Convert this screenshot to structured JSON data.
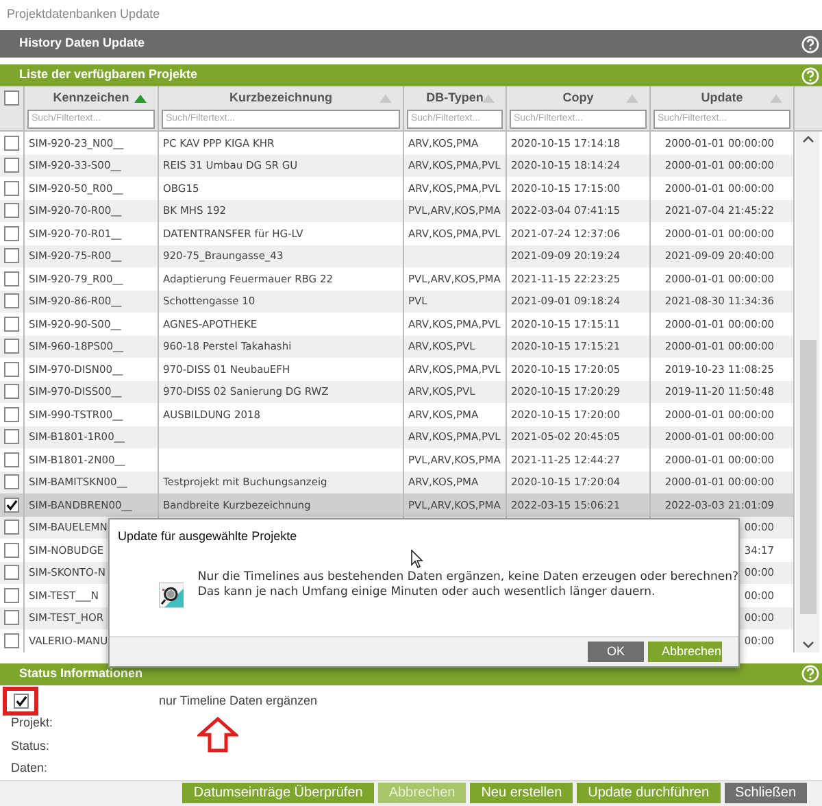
{
  "window": {
    "title": "Projektdatenbanken Update"
  },
  "header": {
    "title": "History Daten Update"
  },
  "list_panel": {
    "title": "Liste der verfügbaren Projekte"
  },
  "table": {
    "all_checked": false,
    "columns": [
      {
        "label": "Kennzeichen",
        "sorted": true,
        "placeholder": "Such/Filtertext..."
      },
      {
        "label": "Kurzbezeichnung",
        "sorted": false,
        "placeholder": "Such/Filtertext..."
      },
      {
        "label": "DB-Typen",
        "sorted": false,
        "placeholder": "Such/Filtertext..."
      },
      {
        "label": "Copy",
        "sorted": false,
        "placeholder": "Such/Filtertext..."
      },
      {
        "label": "Update",
        "sorted": false,
        "placeholder": "Such/Filtertext..."
      }
    ],
    "rows": [
      {
        "checked": false,
        "selected": false,
        "cells": [
          "SIM-920-23_N00__",
          "PC KAV PPP KIGA KHR",
          "ARV,KOS,PMA",
          "2020-10-15 17:14:18",
          "2000-01-01 00:00:00"
        ]
      },
      {
        "checked": false,
        "selected": false,
        "cells": [
          "SIM-920-33-S00__",
          "REIS 31 Umbau DG SR GU",
          "ARV,KOS,PMA,PVL",
          "2020-10-15 18:14:24",
          "2000-01-01 00:00:00"
        ]
      },
      {
        "checked": false,
        "selected": false,
        "cells": [
          "SIM-920-50_R00__",
          "OBG15",
          "ARV,KOS,PMA,PVL",
          "2020-10-15 17:15:00",
          "2000-01-01 00:00:00"
        ]
      },
      {
        "checked": false,
        "selected": false,
        "cells": [
          "SIM-920-70-R00__",
          "BK MHS 192",
          "PVL,ARV,KOS,PMA",
          "2022-03-04 07:41:15",
          "2021-07-04 21:45:22"
        ]
      },
      {
        "checked": false,
        "selected": false,
        "cells": [
          "SIM-920-70-R01__",
          "DATENTRANSFER für HG-LV",
          "ARV,KOS,PMA,PVL",
          "2021-07-24 12:37:06",
          "2000-01-01 00:00:00"
        ]
      },
      {
        "checked": false,
        "selected": false,
        "cells": [
          "SIM-920-75-R00__",
          "920-75_Braungasse_43",
          null,
          "2021-09-09 20:19:24",
          "2021-09-09 20:40:00"
        ]
      },
      {
        "checked": false,
        "selected": false,
        "cells": [
          "SIM-920-79_R00__",
          "Adaptierung Feuermauer RBG 22",
          "PVL,ARV,KOS,PMA",
          "2021-11-15 22:23:25",
          "2000-01-01 00:00:00"
        ]
      },
      {
        "checked": false,
        "selected": false,
        "cells": [
          "SIM-920-86-R00__",
          "Schottengasse 10",
          "PVL",
          "2021-09-01 09:18:24",
          "2021-08-30 11:34:36"
        ]
      },
      {
        "checked": false,
        "selected": false,
        "cells": [
          "SIM-920-90-S00__",
          "AGNES-APOTHEKE",
          "ARV,KOS,PMA,PVL",
          "2020-10-15 17:15:11",
          "2000-01-01 00:00:00"
        ]
      },
      {
        "checked": false,
        "selected": false,
        "cells": [
          "SIM-960-18PS00__",
          "960-18 Perstel Takahashi",
          "ARV,KOS,PVL",
          "2020-10-15 17:15:21",
          "2000-01-01 00:00:00"
        ]
      },
      {
        "checked": false,
        "selected": false,
        "cells": [
          "SIM-970-DISN00__",
          "970-DISS 01 NeubauEFH",
          "ARV,KOS,PMA,PVL",
          "2020-10-15 17:20:05",
          "2019-10-23 11:08:25"
        ]
      },
      {
        "checked": false,
        "selected": false,
        "cells": [
          "SIM-970-DISS00__",
          "970-DISS 02 Sanierung DG RWZ",
          "ARV,KOS,PVL",
          "2020-10-15 17:20:29",
          "2019-11-20 11:50:48"
        ]
      },
      {
        "checked": false,
        "selected": false,
        "cells": [
          "SIM-990-TSTR00__",
          "AUSBILDUNG 2018",
          "ARV,KOS,PMA",
          "2020-10-15 17:20:00",
          "2000-01-01 00:00:00"
        ]
      },
      {
        "checked": false,
        "selected": false,
        "cells": [
          "SIM-B1801-1R00__",
          null,
          "ARV,KOS,PMA,PVL",
          "2021-05-02 20:45:05",
          "2000-01-01 00:00:00"
        ]
      },
      {
        "checked": false,
        "selected": false,
        "cells": [
          "SIM-B1801-2N00__",
          null,
          "PVL,ARV,KOS,PMA",
          "2021-11-25 12:44:27",
          "2000-01-01 00:00:00"
        ]
      },
      {
        "checked": false,
        "selected": false,
        "cells": [
          "SIM-BAMITSKN00__",
          "Testprojekt mit Buchungsanzeig",
          "ARV,KOS,PMA",
          "2020-10-15 17:20:04",
          "2000-01-01 00:00:00"
        ]
      },
      {
        "checked": true,
        "selected": true,
        "cells": [
          "SIM-BANDBREN00__",
          "Bandbreite Kurzbezeichnung",
          "PVL,ARV,KOS,PMA",
          "2022-03-15 15:06:21",
          "2022-03-03 21:01:09"
        ]
      },
      {
        "checked": false,
        "selected": false,
        "cells": [
          "SIM-BAUELEMN",
          null,
          null,
          null,
          "00:00"
        ]
      },
      {
        "checked": false,
        "selected": false,
        "cells": [
          "SIM-NOBUDGE",
          null,
          null,
          null,
          "34:17"
        ]
      },
      {
        "checked": false,
        "selected": false,
        "cells": [
          "SIM-SKONTO-N",
          null,
          null,
          null,
          "00:00"
        ]
      },
      {
        "checked": false,
        "selected": false,
        "cells": [
          "SIM-TEST___N",
          null,
          null,
          null,
          "00:00"
        ]
      },
      {
        "checked": false,
        "selected": false,
        "cells": [
          "SIM-TEST_HOR",
          null,
          null,
          null,
          "00:00"
        ]
      },
      {
        "checked": false,
        "selected": false,
        "cells": [
          "VALERIO-MANU",
          null,
          null,
          null,
          "00:00"
        ]
      }
    ]
  },
  "dialog": {
    "title": "Update für ausgewählte Projekte",
    "message": [
      "Nur die Timelines aus bestehenden Daten ergänzen, keine Daten erzeugen oder berechnen?",
      "Das kann je nach Umfang einige Minuten oder auch wesentlich länger dauern."
    ],
    "buttons": [
      {
        "label": "OK",
        "kind": "secondary"
      },
      {
        "label": "Abbrechen",
        "kind": "primary"
      }
    ]
  },
  "status_panel": {
    "title": "Status Informationen",
    "option": {
      "label": "nur Timeline Daten ergänzen",
      "checked": true,
      "highlighted": true
    },
    "fields": [
      "Projekt:",
      "Status:",
      "Daten:"
    ]
  },
  "buttons": [
    {
      "label": "Datumseinträge Überprüfen",
      "kind": "primary",
      "disabled": false
    },
    {
      "label": "Abbrechen",
      "kind": "primary",
      "disabled": true
    },
    {
      "label": "Neu erstellen",
      "kind": "primary",
      "disabled": false
    },
    {
      "label": "Update durchführen",
      "kind": "primary",
      "disabled": false
    },
    {
      "label": "Schließen",
      "kind": "secondary",
      "disabled": false
    }
  ]
}
